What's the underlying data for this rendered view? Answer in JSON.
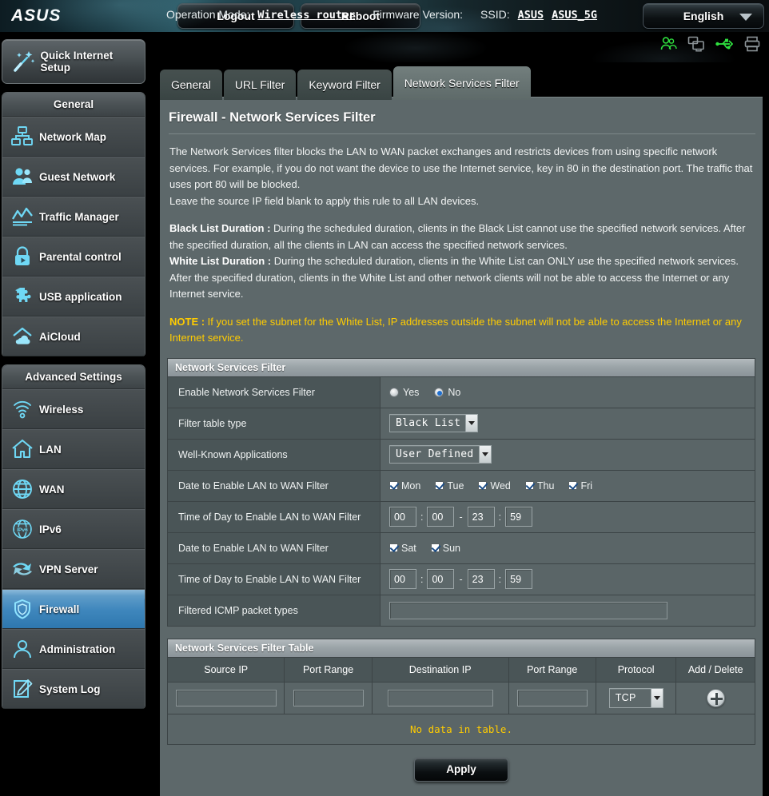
{
  "header": {
    "logo_text": "ASUS",
    "logout_label": "Logout",
    "reboot_label": "Reboot",
    "language_label": "English",
    "operation_mode_label": "Operation Mode:",
    "operation_mode_value": "Wireless router",
    "firmware_label": "Firmware Version:",
    "firmware_value": "",
    "ssid_label": "SSID:",
    "ssid_1": "ASUS",
    "ssid_2": "ASUS_5G",
    "status_icons": [
      {
        "name": "clients-users-icon",
        "color": "#2fe03f"
      },
      {
        "name": "clone-monitors-icon",
        "color": "#8c9498"
      },
      {
        "name": "usb-icon",
        "color": "#2fe03f"
      },
      {
        "name": "printer-icon",
        "color": "#8c9498"
      }
    ]
  },
  "sidebar": {
    "quick_setup_label": "Quick Internet Setup",
    "quick_setup_icon": "magic-wand-icon",
    "general_title": "General",
    "general_items": [
      {
        "label": "Network Map",
        "icon": "network-map-icon"
      },
      {
        "label": "Guest Network",
        "icon": "guest-network-icon"
      },
      {
        "label": "Traffic Manager",
        "icon": "traffic-manager-icon"
      },
      {
        "label": "Parental control",
        "icon": "parental-control-lock-icon"
      },
      {
        "label": "USB application",
        "icon": "usb-application-puzzle-icon"
      },
      {
        "label": "AiCloud",
        "icon": "aicloud-icon"
      }
    ],
    "advanced_title": "Advanced Settings",
    "advanced_items": [
      {
        "label": "Wireless",
        "icon": "wireless-signal-icon",
        "active": false
      },
      {
        "label": "LAN",
        "icon": "lan-home-icon",
        "active": false
      },
      {
        "label": "WAN",
        "icon": "wan-globe-icon",
        "active": false
      },
      {
        "label": "IPv6",
        "icon": "ipv6-globe-icon",
        "active": false
      },
      {
        "label": "VPN Server",
        "icon": "vpn-server-icon",
        "active": false
      },
      {
        "label": "Firewall",
        "icon": "firewall-shield-icon",
        "active": true
      },
      {
        "label": "Administration",
        "icon": "administration-user-icon",
        "active": false
      },
      {
        "label": "System Log",
        "icon": "system-log-pencil-icon",
        "active": false
      }
    ]
  },
  "tabs": [
    {
      "label": "General",
      "active": false
    },
    {
      "label": "URL Filter",
      "active": false
    },
    {
      "label": "Keyword Filter",
      "active": false
    },
    {
      "label": "Network Services Filter",
      "active": true
    }
  ],
  "main": {
    "page_title": "Firewall - Network Services Filter",
    "desc_p1": "The Network Services filter blocks the LAN to WAN packet exchanges and restricts devices from using specific network services. For example, if you do not want the device to use the Internet service, key in 80 in the destination port. The traffic that uses port 80 will be blocked.",
    "desc_p2": "Leave the source IP field blank to apply this rule to all LAN devices.",
    "blacklist_label": "Black List Duration :",
    "blacklist_text": " During the scheduled duration, clients in the Black List cannot use the specified network services. After the specified duration, all the clients in LAN can access the specified network services.",
    "whitelist_label": "White List Duration :",
    "whitelist_text": " During the scheduled duration, clients in the White List can ONLY use the specified network services. After the specified duration, clients in the White List and other network clients will not be able to access the Internet or any Internet service.",
    "note_label": "NOTE :",
    "note_text": " If you set the subnet for the White List, IP addresses outside the subnet will not be able to access the Internet or any Internet service."
  },
  "form": {
    "section_title": "Network Services Filter",
    "enable_label": "Enable Network Services Filter",
    "enable_yes": "Yes",
    "enable_no": "No",
    "enable_value": "No",
    "filter_table_type_label": "Filter table type",
    "filter_table_type_value": "Black List",
    "well_known_label": "Well-Known Applications",
    "well_known_value": "User Defined",
    "date_label_1": "Date to Enable LAN to WAN Filter",
    "days_weekday": [
      "Mon",
      "Tue",
      "Wed",
      "Thu",
      "Fri"
    ],
    "time_label_1": "Time of Day to Enable LAN to WAN Filter",
    "time_1": {
      "start_h": "00",
      "start_m": "00",
      "end_h": "23",
      "end_m": "59"
    },
    "date_label_2": "Date to Enable LAN to WAN Filter",
    "days_weekend": [
      "Sat",
      "Sun"
    ],
    "time_label_2": "Time of Day to Enable LAN to WAN Filter",
    "time_2": {
      "start_h": "00",
      "start_m": "00",
      "end_h": "23",
      "end_m": "59"
    },
    "icmp_label": "Filtered ICMP packet types",
    "icmp_value": ""
  },
  "table": {
    "section_title": "Network Services Filter Table",
    "columns": [
      "Source IP",
      "Port Range",
      "Destination IP",
      "Port Range",
      "Protocol",
      "Add / Delete"
    ],
    "input_row": {
      "source_ip": "",
      "port_range_1": "",
      "destination_ip": "",
      "port_range_2": "",
      "protocol": "TCP",
      "add_icon": "plus-circle-icon"
    },
    "empty_message": "No data in table.",
    "apply_label": "Apply"
  },
  "colors": {
    "accent_blue": "#3f87bd",
    "note_yellow": "#ffcc00",
    "icon_cyan": "#66d9f5",
    "panel_bg": "#5d686a"
  }
}
